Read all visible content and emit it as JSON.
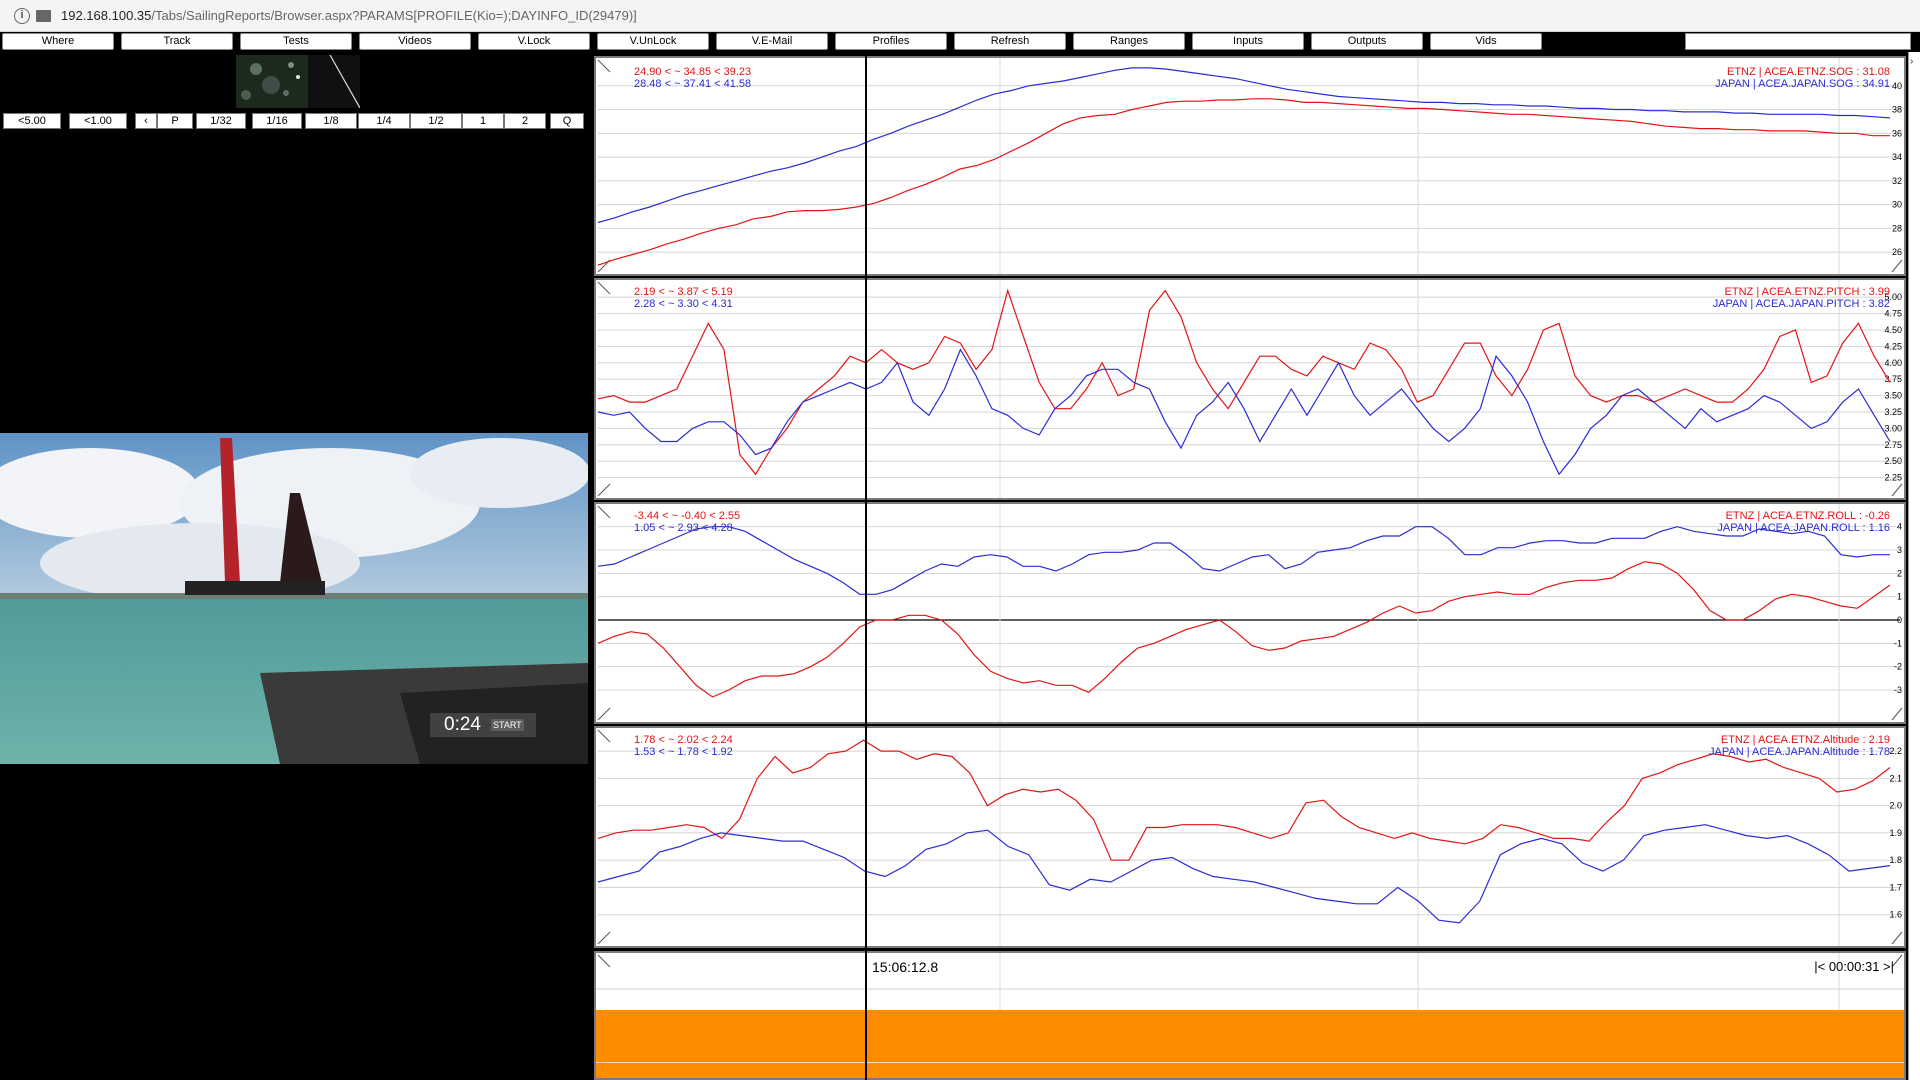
{
  "address_bar": {
    "host": "192.168.100.35",
    "path": "/Tabs/SailingReports/Browser.aspx?PARAMS[PROFILE(Kio=);DAYINFO_ID(29479)]"
  },
  "menu": [
    "Where",
    "Track",
    "Tests",
    "Videos",
    "V.Lock",
    "V.UnLock",
    "V.E-Mail",
    "Profiles",
    "Refresh",
    "Ranges",
    "Inputs",
    "Outputs",
    "Vids"
  ],
  "playback": [
    "<5.00",
    "<1.00",
    "‹",
    "P",
    "1/32",
    "1/16",
    "1/8",
    "1/4",
    "1/2",
    "1",
    "2",
    "Q"
  ],
  "video": {
    "time": "0:24",
    "badge": "START"
  },
  "colors": {
    "etnz": "#e41414",
    "japan": "#2b2bd6",
    "timeline": "#ff8c00"
  },
  "charts": [
    {
      "id": "sog",
      "red_stat": "24.90 < ~ 34.85 < 39.23",
      "blue_stat": "28.48 < ~ 37.41 < 41.58",
      "red_label": "ETNZ | ACEA.ETNZ.SOG : 31.08",
      "blue_label": "JAPAN | ACEA.JAPAN.SOG : 34.91",
      "ticks": [
        "40",
        "38",
        "36",
        "34",
        "32",
        "30",
        "28",
        "26"
      ],
      "y_min": 24.5,
      "y_max": 42,
      "red": [
        24.9,
        25.4,
        25.8,
        26.2,
        26.7,
        27.1,
        27.6,
        28.0,
        28.3,
        28.8,
        29.0,
        29.4,
        29.5,
        29.5,
        29.6,
        29.8,
        30.1,
        30.6,
        31.2,
        31.7,
        32.3,
        33.0,
        33.3,
        33.8,
        34.5,
        35.2,
        36.0,
        36.8,
        37.3,
        37.5,
        37.6,
        38.0,
        38.3,
        38.6,
        38.7,
        38.7,
        38.8,
        38.8,
        38.9,
        38.9,
        38.8,
        38.6,
        38.6,
        38.5,
        38.4,
        38.3,
        38.2,
        38.1,
        38.1,
        38.0,
        37.9,
        37.8,
        37.7,
        37.6,
        37.6,
        37.5,
        37.4,
        37.3,
        37.2,
        37.1,
        37.0,
        36.8,
        36.6,
        36.5,
        36.4,
        36.4,
        36.3,
        36.3,
        36.2,
        36.2,
        36.2,
        36.1,
        36.0,
        36.0,
        35.8,
        35.8
      ],
      "blue": [
        28.5,
        28.9,
        29.4,
        29.8,
        30.3,
        30.8,
        31.2,
        31.6,
        32.0,
        32.4,
        32.8,
        33.1,
        33.5,
        34.0,
        34.5,
        34.9,
        35.5,
        36.0,
        36.6,
        37.1,
        37.6,
        38.2,
        38.8,
        39.3,
        39.6,
        40.0,
        40.2,
        40.4,
        40.7,
        41.0,
        41.3,
        41.5,
        41.5,
        41.4,
        41.2,
        41.0,
        40.8,
        40.6,
        40.3,
        40.0,
        39.7,
        39.5,
        39.3,
        39.1,
        39.0,
        38.9,
        38.8,
        38.7,
        38.6,
        38.6,
        38.5,
        38.5,
        38.4,
        38.4,
        38.3,
        38.3,
        38.2,
        38.1,
        38.1,
        38.0,
        38.0,
        37.9,
        37.9,
        37.8,
        37.8,
        37.8,
        37.7,
        37.7,
        37.6,
        37.6,
        37.6,
        37.6,
        37.5,
        37.5,
        37.4,
        37.3
      ]
    },
    {
      "id": "pitch",
      "red_stat": "2.19 < ~ 3.87 < 5.19",
      "blue_stat": "2.28 < ~ 3.30 < 4.31",
      "red_label": "ETNZ | ACEA.ETNZ.PITCH : 3.99",
      "blue_label": "JAPAN | ACEA.JAPAN.PITCH : 3.82",
      "ticks": [
        "5.00",
        "4.75",
        "4.50",
        "4.25",
        "4.00",
        "3.75",
        "3.50",
        "3.25",
        "3.00",
        "2.75",
        "2.50",
        "2.25"
      ],
      "y_min": 2.0,
      "y_max": 5.2,
      "red": [
        3.45,
        3.5,
        3.4,
        3.4,
        3.5,
        3.6,
        4.1,
        4.6,
        4.2,
        2.6,
        2.3,
        2.7,
        3.0,
        3.4,
        3.6,
        3.8,
        4.1,
        4.0,
        4.2,
        4.0,
        3.9,
        4.0,
        4.4,
        4.3,
        3.9,
        4.2,
        5.1,
        4.4,
        3.7,
        3.3,
        3.3,
        3.6,
        4.0,
        3.5,
        3.6,
        4.8,
        5.1,
        4.7,
        4.0,
        3.6,
        3.3,
        3.7,
        4.1,
        4.1,
        3.9,
        3.8,
        4.1,
        4.0,
        3.9,
        4.3,
        4.2,
        3.9,
        3.4,
        3.5,
        3.9,
        4.3,
        4.3,
        3.8,
        3.5,
        3.9,
        4.5,
        4.6,
        3.8,
        3.5,
        3.4,
        3.5,
        3.5,
        3.4,
        3.5,
        3.6,
        3.5,
        3.4,
        3.4,
        3.6,
        3.9,
        4.4,
        4.5,
        3.7,
        3.8,
        4.3,
        4.6,
        4.1,
        3.7
      ],
      "blue": [
        3.25,
        3.2,
        3.25,
        3.0,
        2.8,
        2.8,
        3.0,
        3.1,
        3.1,
        2.9,
        2.6,
        2.7,
        3.1,
        3.4,
        3.5,
        3.6,
        3.7,
        3.6,
        3.7,
        4.0,
        3.4,
        3.2,
        3.6,
        4.2,
        3.8,
        3.3,
        3.2,
        3.0,
        2.9,
        3.3,
        3.5,
        3.8,
        3.9,
        3.9,
        3.7,
        3.6,
        3.1,
        2.7,
        3.2,
        3.4,
        3.7,
        3.3,
        2.8,
        3.2,
        3.6,
        3.2,
        3.6,
        4.0,
        3.5,
        3.2,
        3.4,
        3.6,
        3.3,
        3.0,
        2.8,
        3.0,
        3.3,
        4.1,
        3.8,
        3.4,
        2.8,
        2.3,
        2.6,
        3.0,
        3.2,
        3.5,
        3.6,
        3.4,
        3.2,
        3.0,
        3.3,
        3.1,
        3.2,
        3.3,
        3.5,
        3.4,
        3.2,
        3.0,
        3.1,
        3.4,
        3.6,
        3.2,
        2.8
      ]
    },
    {
      "id": "roll",
      "red_stat": "-3.44 < ~ -0.40 < 2.55",
      "blue_stat": "1.05 < ~ 2.93 < 4.28",
      "red_label": "ETNZ | ACEA.ETNZ.ROLL : -0.26",
      "blue_label": "JAPAN | ACEA.JAPAN.ROLL : 1.16",
      "ticks": [
        "4",
        "3",
        "2",
        "1",
        "0",
        "-1",
        "-2",
        "-3"
      ],
      "y_min": -4.2,
      "y_max": 4.8,
      "red": [
        -1.0,
        -0.7,
        -0.5,
        -0.6,
        -1.2,
        -2.0,
        -2.8,
        -3.3,
        -3.0,
        -2.6,
        -2.4,
        -2.4,
        -2.3,
        -2.0,
        -1.6,
        -1.0,
        -0.3,
        0.0,
        0.0,
        0.2,
        0.2,
        0.0,
        -0.6,
        -1.5,
        -2.2,
        -2.5,
        -2.7,
        -2.6,
        -2.8,
        -2.8,
        -3.1,
        -2.5,
        -1.8,
        -1.2,
        -1.0,
        -0.7,
        -0.4,
        -0.2,
        0.0,
        -0.5,
        -1.1,
        -1.3,
        -1.2,
        -0.9,
        -0.8,
        -0.7,
        -0.4,
        -0.1,
        0.3,
        0.6,
        0.3,
        0.4,
        0.8,
        1.0,
        1.1,
        1.2,
        1.1,
        1.1,
        1.4,
        1.6,
        1.7,
        1.7,
        1.8,
        2.2,
        2.5,
        2.4,
        2.0,
        1.3,
        0.4,
        0.0,
        0.0,
        0.4,
        0.9,
        1.1,
        1.0,
        0.8,
        0.6,
        0.5,
        1.0,
        1.5
      ],
      "blue": [
        2.3,
        2.4,
        2.7,
        3.0,
        3.3,
        3.6,
        3.9,
        4.0,
        4.0,
        3.8,
        3.4,
        3.0,
        2.6,
        2.3,
        2.0,
        1.6,
        1.1,
        1.1,
        1.3,
        1.7,
        2.1,
        2.4,
        2.3,
        2.7,
        2.8,
        2.7,
        2.3,
        2.3,
        2.1,
        2.4,
        2.8,
        2.9,
        2.9,
        3.0,
        3.3,
        3.3,
        2.8,
        2.2,
        2.1,
        2.4,
        2.7,
        2.8,
        2.2,
        2.4,
        2.9,
        3.0,
        3.1,
        3.4,
        3.6,
        3.6,
        4.0,
        4.0,
        3.5,
        2.8,
        2.8,
        3.1,
        3.1,
        3.3,
        3.4,
        3.4,
        3.3,
        3.3,
        3.5,
        3.5,
        3.5,
        3.8,
        4.0,
        3.8,
        3.7,
        3.6,
        3.6,
        3.9,
        3.8,
        3.7,
        3.8,
        3.6,
        2.8,
        2.7,
        2.8,
        2.8
      ]
    },
    {
      "id": "altitude",
      "red_stat": "1.78 < ~ 2.02 < 2.24",
      "blue_stat": "1.53 < ~ 1.78 < 1.92",
      "red_label": "ETNZ | ACEA.ETNZ.Altitude : 2.19",
      "blue_label": "JAPAN | ACEA.JAPAN.Altitude : 1.78",
      "ticks": [
        "2.2",
        "2.1",
        "2.0",
        "1.9",
        "1.8",
        "1.7",
        "1.6"
      ],
      "y_min": 1.5,
      "y_max": 2.27,
      "red": [
        1.88,
        1.9,
        1.91,
        1.91,
        1.92,
        1.93,
        1.92,
        1.88,
        1.95,
        2.1,
        2.18,
        2.12,
        2.14,
        2.19,
        2.2,
        2.24,
        2.2,
        2.2,
        2.17,
        2.19,
        2.18,
        2.12,
        2.0,
        2.04,
        2.06,
        2.05,
        2.06,
        2.02,
        1.95,
        1.8,
        1.8,
        1.92,
        1.92,
        1.93,
        1.93,
        1.93,
        1.92,
        1.9,
        1.88,
        1.9,
        2.01,
        2.02,
        1.96,
        1.92,
        1.9,
        1.88,
        1.9,
        1.88,
        1.87,
        1.86,
        1.88,
        1.93,
        1.92,
        1.9,
        1.88,
        1.88,
        1.87,
        1.94,
        2.0,
        2.1,
        2.12,
        2.15,
        2.17,
        2.19,
        2.18,
        2.16,
        2.17,
        2.14,
        2.12,
        2.1,
        2.05,
        2.06,
        2.09,
        2.14
      ],
      "blue": [
        1.72,
        1.74,
        1.76,
        1.83,
        1.85,
        1.88,
        1.9,
        1.89,
        1.88,
        1.87,
        1.87,
        1.84,
        1.81,
        1.76,
        1.74,
        1.78,
        1.84,
        1.86,
        1.9,
        1.91,
        1.85,
        1.82,
        1.71,
        1.69,
        1.73,
        1.72,
        1.76,
        1.8,
        1.81,
        1.77,
        1.74,
        1.73,
        1.72,
        1.7,
        1.68,
        1.66,
        1.65,
        1.64,
        1.64,
        1.7,
        1.65,
        1.58,
        1.57,
        1.65,
        1.82,
        1.86,
        1.88,
        1.86,
        1.79,
        1.76,
        1.8,
        1.89,
        1.91,
        1.92,
        1.93,
        1.91,
        1.89,
        1.88,
        1.89,
        1.86,
        1.82,
        1.76,
        1.77,
        1.78
      ]
    }
  ],
  "timeline": {
    "time": "15:06:12.8",
    "duration": "|< 00:00:31 >|"
  }
}
